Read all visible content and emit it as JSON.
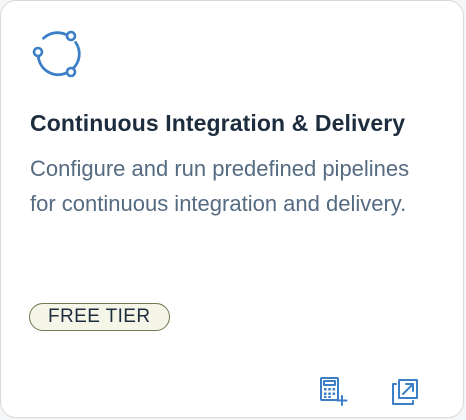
{
  "card": {
    "title": "Continuous Integration & Delivery",
    "description": "Configure and run predefined pipelines for continuous integration and delivery.",
    "badge": "FREE TIER",
    "icon": "cicd-cycle-icon"
  },
  "actions": [
    {
      "icon": "calculator-add-icon"
    },
    {
      "icon": "open-in-new-window-icon"
    }
  ],
  "colors": {
    "accent": "#3c7fc7",
    "title": "#1d2d3e",
    "description": "#556b82",
    "badge_border": "#6b7a4f",
    "badge_bg": "#f5f6e8"
  }
}
